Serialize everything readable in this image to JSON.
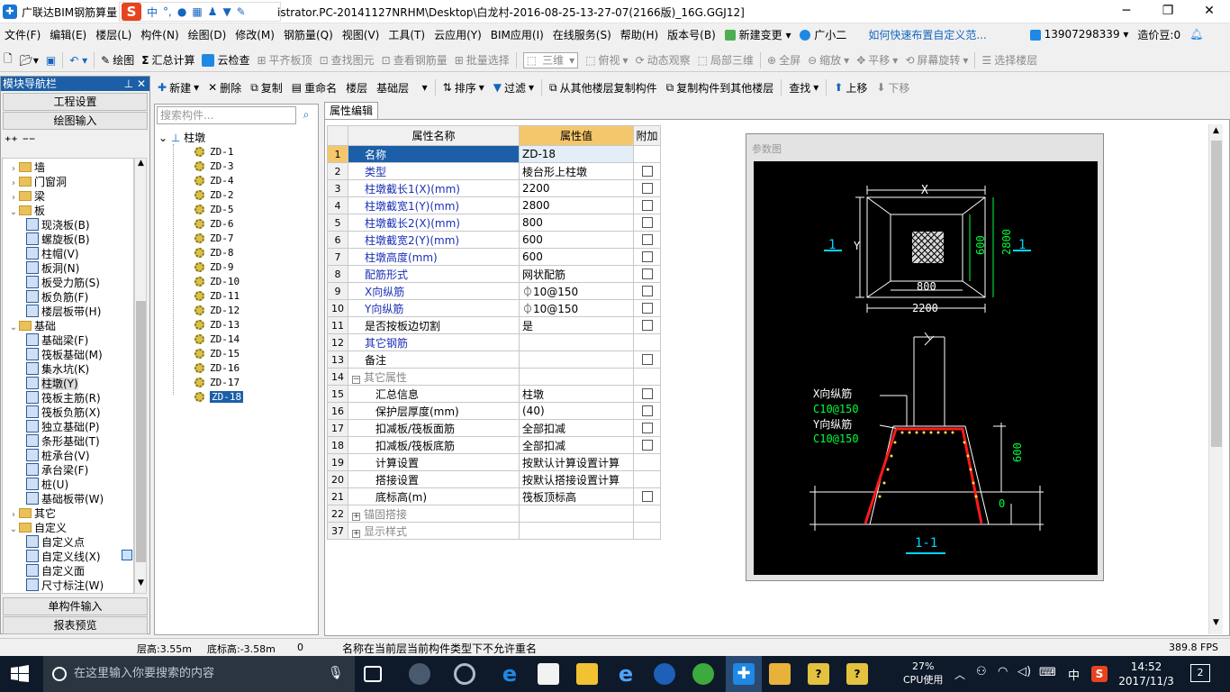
{
  "window": {
    "title_left": "广联达BIM钢筋算量",
    "title_right": "istrator.PC-20141127NRHM\\Desktop\\白龙村-2016-08-25-13-27-07(2166版)_16G.GGJ12]"
  },
  "ime": {
    "brand": "S",
    "lang": "中"
  },
  "menu": [
    "文件(F)",
    "编辑(E)",
    "楼层(L)",
    "构件(N)",
    "绘图(D)",
    "修改(M)",
    "钢筋量(Q)",
    "视图(V)",
    "工具(T)",
    "云应用(Y)",
    "BIM应用(I)",
    "在线服务(S)",
    "帮助(H)",
    "版本号(B)",
    "新建变更",
    "广小二",
    "如何快速布置自定义范...",
    "13907298339",
    "造价豆:0"
  ],
  "toolbar1": {
    "draw": "绘图",
    "summary": "汇总计算",
    "cloud_check": "云检查",
    "align_top": "平齐板顶",
    "find_elem": "查找图元",
    "view_rebar": "查看钢筋量",
    "batch_select": "批量选择",
    "view_mode": "三维",
    "top_view": "俯视",
    "dynamic": "动态观察",
    "local3d": "局部三维",
    "fullscreen": "全屏",
    "zoom": "缩放",
    "pan": "平移",
    "rotate": "屏幕旋转",
    "select_floor": "选择楼层"
  },
  "toolbar2": {
    "new": "新建",
    "delete": "删除",
    "copy": "复制",
    "rename": "重命名",
    "floor_label": "楼层",
    "floor_value": "基础层",
    "sort": "排序",
    "filter": "过滤",
    "copy_from": "从其他楼层复制构件",
    "copy_to": "复制构件到其他楼层",
    "find": "查找",
    "up": "上移",
    "down": "下移"
  },
  "nav": {
    "header": "模块导航栏",
    "project_settings": "工程设置",
    "drawing_input": "绘图输入",
    "single_input": "单构件输入",
    "report_preview": "报表预览",
    "tree": [
      {
        "label": "墙",
        "type": "folder",
        "level": 0,
        "exp": "›"
      },
      {
        "label": "门窗洞",
        "type": "folder",
        "level": 0,
        "exp": "›"
      },
      {
        "label": "梁",
        "type": "folder",
        "level": 0,
        "exp": "›"
      },
      {
        "label": "板",
        "type": "folder",
        "level": 0,
        "exp": "⌄"
      },
      {
        "label": "现浇板(B)",
        "type": "item",
        "level": 1
      },
      {
        "label": "螺旋板(B)",
        "type": "item",
        "level": 1
      },
      {
        "label": "柱帽(V)",
        "type": "item",
        "level": 1
      },
      {
        "label": "板洞(N)",
        "type": "item",
        "level": 1
      },
      {
        "label": "板受力筋(S)",
        "type": "item",
        "level": 1
      },
      {
        "label": "板负筋(F)",
        "type": "item",
        "level": 1
      },
      {
        "label": "楼层板带(H)",
        "type": "item",
        "level": 1
      },
      {
        "label": "基础",
        "type": "folder",
        "level": 0,
        "exp": "⌄"
      },
      {
        "label": "基础梁(F)",
        "type": "item",
        "level": 1
      },
      {
        "label": "筏板基础(M)",
        "type": "item",
        "level": 1
      },
      {
        "label": "集水坑(K)",
        "type": "item",
        "level": 1
      },
      {
        "label": "柱墩(Y)",
        "type": "item",
        "level": 1,
        "selected": true
      },
      {
        "label": "筏板主筋(R)",
        "type": "item",
        "level": 1
      },
      {
        "label": "筏板负筋(X)",
        "type": "item",
        "level": 1
      },
      {
        "label": "独立基础(P)",
        "type": "item",
        "level": 1
      },
      {
        "label": "条形基础(T)",
        "type": "item",
        "level": 1
      },
      {
        "label": "桩承台(V)",
        "type": "item",
        "level": 1
      },
      {
        "label": "承台梁(F)",
        "type": "item",
        "level": 1
      },
      {
        "label": "桩(U)",
        "type": "item",
        "level": 1
      },
      {
        "label": "基础板带(W)",
        "type": "item",
        "level": 1
      },
      {
        "label": "其它",
        "type": "folder",
        "level": 0,
        "exp": "›"
      },
      {
        "label": "自定义",
        "type": "folder",
        "level": 0,
        "exp": "⌄"
      },
      {
        "label": "自定义点",
        "type": "item",
        "level": 1
      },
      {
        "label": "自定义线(X)",
        "type": "item",
        "level": 1
      },
      {
        "label": "自定义面",
        "type": "item",
        "level": 1
      },
      {
        "label": "尺寸标注(W)",
        "type": "item",
        "level": 1
      }
    ]
  },
  "components": {
    "search_placeholder": "搜索构件...",
    "root": "柱墩",
    "items": [
      "ZD-1",
      "ZD-3",
      "ZD-4",
      "ZD-2",
      "ZD-5",
      "ZD-6",
      "ZD-7",
      "ZD-8",
      "ZD-9",
      "ZD-10",
      "ZD-11",
      "ZD-12",
      "ZD-13",
      "ZD-14",
      "ZD-15",
      "ZD-16",
      "ZD-17",
      "ZD-18"
    ],
    "selected": "ZD-18"
  },
  "properties": {
    "tab": "属性编辑",
    "headers": {
      "name": "属性名称",
      "value": "属性值",
      "extra": "附加"
    },
    "rows": [
      {
        "n": "1",
        "name": "名称",
        "value": "ZD-18",
        "cb": false,
        "style": "blue"
      },
      {
        "n": "2",
        "name": "类型",
        "value": "棱台形上柱墩",
        "cb": true,
        "style": "blue"
      },
      {
        "n": "3",
        "name": "柱墩截长1(X)(mm)",
        "value": "2200",
        "cb": true,
        "style": "blue"
      },
      {
        "n": "4",
        "name": "柱墩截宽1(Y)(mm)",
        "value": "2800",
        "cb": true,
        "style": "blue"
      },
      {
        "n": "5",
        "name": "柱墩截长2(X)(mm)",
        "value": "800",
        "cb": true,
        "style": "blue"
      },
      {
        "n": "6",
        "name": "柱墩截宽2(Y)(mm)",
        "value": "600",
        "cb": true,
        "style": "blue"
      },
      {
        "n": "7",
        "name": "柱墩高度(mm)",
        "value": "600",
        "cb": true,
        "style": "blue"
      },
      {
        "n": "8",
        "name": "配筋形式",
        "value": "网状配筋",
        "cb": true,
        "style": "blue"
      },
      {
        "n": "9",
        "name": "X向纵筋",
        "value": "⏀10@150",
        "cb": true,
        "style": "blue"
      },
      {
        "n": "10",
        "name": "Y向纵筋",
        "value": "⏀10@150",
        "cb": true,
        "style": "blue"
      },
      {
        "n": "11",
        "name": "是否按板边切割",
        "value": "是",
        "cb": true,
        "style": "black"
      },
      {
        "n": "12",
        "name": "其它钢筋",
        "value": "",
        "cb": false,
        "style": "blue"
      },
      {
        "n": "13",
        "name": "备注",
        "value": "",
        "cb": true,
        "style": "black"
      },
      {
        "n": "14",
        "name": "其它属性",
        "value": "",
        "cb": false,
        "style": "group",
        "pm": "−"
      },
      {
        "n": "15",
        "name": "汇总信息",
        "value": "柱墩",
        "cb": true,
        "style": "indent"
      },
      {
        "n": "16",
        "name": "保护层厚度(mm)",
        "value": "(40)",
        "cb": true,
        "style": "indent"
      },
      {
        "n": "17",
        "name": "扣减板/筏板面筋",
        "value": "全部扣减",
        "cb": true,
        "style": "indent"
      },
      {
        "n": "18",
        "name": "扣减板/筏板底筋",
        "value": "全部扣减",
        "cb": true,
        "style": "indent"
      },
      {
        "n": "19",
        "name": "计算设置",
        "value": "按默认计算设置计算",
        "cb": false,
        "style": "indent"
      },
      {
        "n": "20",
        "name": "搭接设置",
        "value": "按默认搭接设置计算",
        "cb": false,
        "style": "indent"
      },
      {
        "n": "21",
        "name": "底标高(m)",
        "value": "筏板顶标高",
        "cb": true,
        "style": "indent"
      },
      {
        "n": "22",
        "name": "锚固搭接",
        "value": "",
        "cb": false,
        "style": "group",
        "pm": "+"
      },
      {
        "n": "37",
        "name": "显示样式",
        "value": "",
        "cb": false,
        "style": "group",
        "pm": "+"
      }
    ]
  },
  "diagram": {
    "title": "参数图",
    "labels": {
      "x": "X",
      "y": "Y",
      "d600": "600",
      "d2800": "2800",
      "d800": "800",
      "d2200": "2200",
      "sec_left": "1",
      "sec_right": "1",
      "xbar": "X向纵筋",
      "xbar_spec": "C10@150",
      "ybar": "Y向纵筋",
      "ybar_spec": "C10@150",
      "h600": "600",
      "zero": "0",
      "section": "1-1"
    }
  },
  "status": {
    "floor_height": "层高:3.55m",
    "bottom_elev": "底标高:-3.58m",
    "zero": "0",
    "message": "名称在当前层当前构件类型下不允许重名",
    "fps": "389.8 FPS"
  },
  "taskbar": {
    "search": "在这里输入你要搜索的内容",
    "cpu": "27%",
    "cpu_label": "CPU使用",
    "ime": "中",
    "time": "14:52",
    "date": "2017/11/3",
    "notif": "2"
  },
  "colors": {
    "accent": "#1c5fa8",
    "diagram_bg": "#000000",
    "dim_white": "#ffffff",
    "dim_green": "#00ff3b",
    "cyan": "#00d7ff",
    "rebar_red": "#ff1a1a"
  }
}
